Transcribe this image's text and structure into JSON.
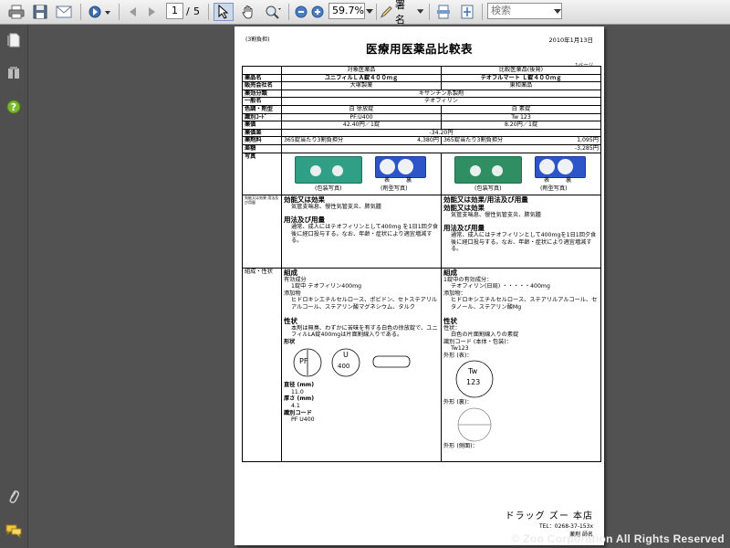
{
  "toolbar": {
    "page_current": "1",
    "page_sep": "/",
    "page_total": "5",
    "zoom": "59.7%",
    "sign_label": "署名",
    "search_placeholder": "検索"
  },
  "doc": {
    "tag": "(3割負担)",
    "title": "医療用医薬品比較表",
    "date": "2010年1月13日",
    "page_label": "1ページ",
    "col_target": "対象医薬品",
    "col_compare": "比較医薬品(後発)",
    "rows": {
      "name": {
        "label": "薬品名",
        "a": "ユニフィルＬＡ錠４００ｍｇ",
        "b": "テオフルマート Ｌ錠４００ｍｇ"
      },
      "maker": {
        "label": "販売会社名",
        "a": "大塚製薬",
        "b": "東和薬品"
      },
      "effect": {
        "label": "薬効分類",
        "v": "キサンチン系製剤"
      },
      "generic": {
        "label": "一般名",
        "v": "テオフィリン"
      },
      "color": {
        "label": "色調・剤型",
        "a": "白 徐放錠",
        "b": "白 素錠"
      },
      "code": {
        "label": "識別ｺｰﾄﾞ",
        "a": "PF:U400",
        "b": "Tw 123"
      },
      "price": {
        "label": "薬価",
        "a": "42.40円／1錠",
        "b": "8.20円／1錠"
      },
      "diff": {
        "label": "薬価差",
        "v": "-34.20円"
      },
      "cost": {
        "label": "薬剤料",
        "a1": "365錠当たり3割負担分",
        "a2": "4,380円",
        "b1": "365錠当たり3割負担分",
        "b2": "1,095円"
      },
      "total_diff": {
        "label": "差額",
        "v": "-3,285円"
      },
      "photo": {
        "label": "写真",
        "a_pkg": "(包装写真)",
        "a_tab": "(剤型写真)",
        "b_pkg": "(包装写真)",
        "b_tab": "(剤型写真)",
        "front": "表",
        "back": "裏"
      }
    },
    "indication": {
      "label": "効能又は効果 用法及び用量",
      "a_head1": "効能又は効果",
      "a_text1": "気管支喘息、慢性気管支炎、肺気腫",
      "a_head2": "用法及び用量",
      "a_text2": "通常、成人にはテオフィリンとして400mg を1日1回夕食後に経口投与する。なお、年齢・症状により適宜増減する。",
      "b_head0": "効能又は効果/用法及び用量",
      "b_head1": "効能又は効果",
      "b_text1": "気管支喘息、慢性気管支炎、肺気腫",
      "b_head2": "用法及び用量",
      "b_text2": "通常、成人にはテオフィリンとして400mgを1日1回夕食後に経口投与する。なお、年齢・症状により適宜増減する。"
    },
    "composition": {
      "label": "組成・性状",
      "a_head": "組成",
      "a_l1": "有効成分",
      "a_l2": "1錠中 テオフィリン400mg",
      "a_l3": "添加物",
      "a_l4": "ヒドロキシエチルセルロース、ポビドン、セトステアリルアルコール、ステアリン酸マグネシウム、タルク",
      "a_head2": "性状",
      "a_l5": "本剤は無臭、わずかに苦味を有する白色の徐放錠で、ユニフィルLA錠400mgは片面割線入りである。",
      "a_shape": "形状",
      "a_stamp1": "PF",
      "a_stamp2": "U",
      "a_stamp3": "400",
      "a_dia": "直径 (mm)",
      "a_dia_v": "11.0",
      "a_thk": "厚さ (mm)",
      "a_thk_v": "4.1",
      "a_code": "識別コード",
      "a_code_v": "PF U400",
      "b_head": "組成",
      "b_l1": "1錠中の有効成分：",
      "b_l2": "テオフィリン(日局) ・・・・・400mg",
      "b_l3": "添加物：",
      "b_l4": "ヒドロキシエチルセルロース、ステアリルアルコール、セタノール、ステアリン酸Mg",
      "b_head2": "性状",
      "b_l5": "性状：",
      "b_l6": "白色の片面割線入りの素錠",
      "b_l7": "識別コード (本体・包装)：",
      "b_l8": "Tw123",
      "b_front": "外形 (表)：",
      "b_stamp1": "Tw",
      "b_stamp2": "123",
      "b_back": "外形 (裏)：",
      "b_side": "外形 (側面)："
    },
    "footer": {
      "store": "ドラッグ ズー 本店",
      "tel": "TEL：0268-37-153x",
      "staff": "薬剤 師名"
    }
  },
  "watermark": "© Zoo Corporation All Rights Reserved",
  "colors": {
    "toolbar": "#e6e6e6",
    "background": "#525252",
    "sidebar": "#4f4f4f"
  }
}
